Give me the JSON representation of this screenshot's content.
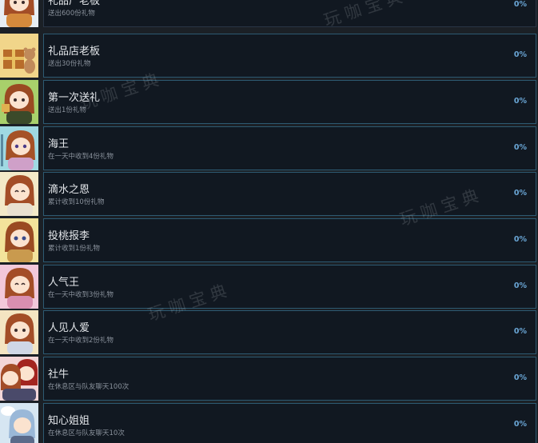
{
  "watermark": "玩咖宝典",
  "achievements": [
    {
      "title": "礼品厂老板",
      "desc": "送出600份礼物",
      "percent": "0%",
      "icon": "gift-master-portrait-icon",
      "bg": "#e7eef4",
      "hair": "#a34d27",
      "skin": "#fbe3cf",
      "cloth": "#d58a3c"
    },
    {
      "title": "礼品店老板",
      "desc": "送出30份礼物",
      "percent": "0%",
      "icon": "gift-box-bear-icon",
      "bg": "#f1d58a",
      "hair": "#a34d27",
      "skin": "#fbe3cf",
      "cloth": "#b86c2a"
    },
    {
      "title": "第一次送礼",
      "desc": "送出1份礼物",
      "percent": "0%",
      "icon": "first-gift-portrait-icon",
      "bg": "#a8d06b",
      "hair": "#9a4a22",
      "skin": "#fbe3cf",
      "cloth": "#3b4a2a"
    },
    {
      "title": "海王",
      "desc": "在一天中收到4份礼物",
      "percent": "0%",
      "icon": "sea-king-portrait-icon",
      "bg": "#9fd9e2",
      "hair": "#a55227",
      "skin": "#fbe3cf",
      "cloth": "#cfa0c8"
    },
    {
      "title": "滴水之恩",
      "desc": "累计收到10份礼物",
      "percent": "0%",
      "icon": "water-drop-portrait-icon",
      "bg": "#f3e9c8",
      "hair": "#a34d27",
      "skin": "#fbe3cf",
      "cloth": "#e9e0d0"
    },
    {
      "title": "投桃报李",
      "desc": "累计收到1份礼物",
      "percent": "0%",
      "icon": "peach-plum-portrait-icon",
      "bg": "#f3e39b",
      "hair": "#9a4a22",
      "skin": "#fbe3cf",
      "cloth": "#c99a4e"
    },
    {
      "title": "人气王",
      "desc": "在一天中收到3份礼物",
      "percent": "0%",
      "icon": "popularity-portrait-icon",
      "bg": "#f2c8da",
      "hair": "#a34d27",
      "skin": "#fbe3cf",
      "cloth": "#d98fb0"
    },
    {
      "title": "人见人爱",
      "desc": "在一天中收到2份礼物",
      "percent": "0%",
      "icon": "beloved-portrait-icon",
      "bg": "#f4e5c2",
      "hair": "#a34d27",
      "skin": "#fbe3cf",
      "cloth": "#cfd7e6"
    },
    {
      "title": "社牛",
      "desc": "在休息区与队友聊天100次",
      "percent": "0%",
      "icon": "social-pair-portrait-icon",
      "bg": "#f3d6d8",
      "hair": "#a3241f",
      "skin": "#fbe3cf",
      "cloth": "#4a4a6a"
    },
    {
      "title": "知心姐姐",
      "desc": "在休息区与队友聊天10次",
      "percent": "0%",
      "icon": "chat-bubble-portrait-icon",
      "bg": "#d6e6f2",
      "hair": "#9ab8d8",
      "skin": "#fbe3cf",
      "cloth": "#5a6a8a"
    }
  ]
}
